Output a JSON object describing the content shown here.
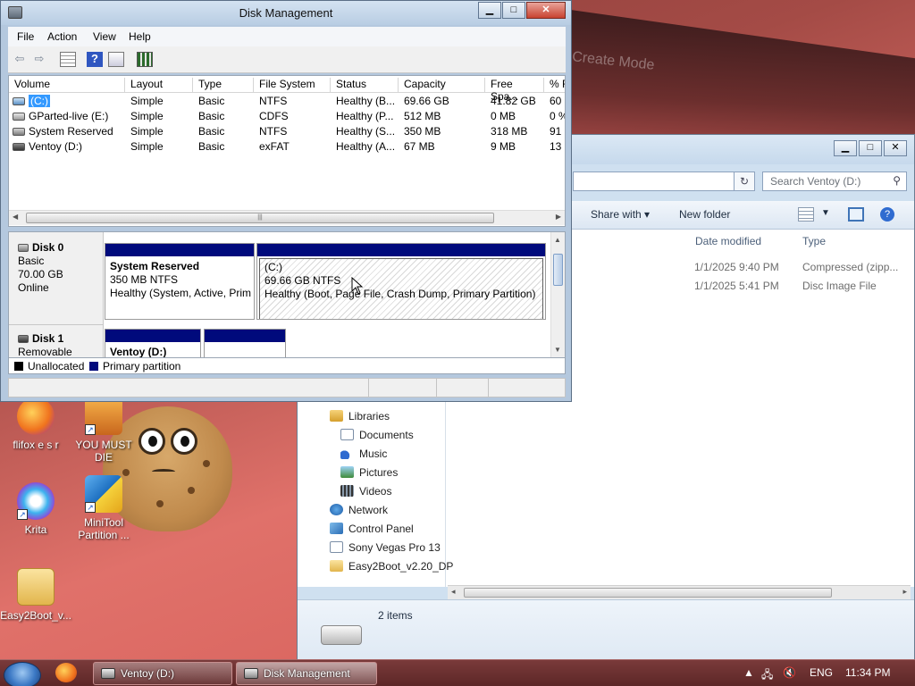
{
  "disk_mgmt": {
    "title": "Disk Management",
    "window_controls": {
      "minimize": "▁",
      "maximize": "□",
      "close": "✕"
    },
    "menu": [
      "File",
      "Action",
      "View",
      "Help"
    ],
    "columns": [
      "Volume",
      "Layout",
      "Type",
      "File System",
      "Status",
      "Capacity",
      "Free Spa...",
      "% F"
    ],
    "volumes": [
      {
        "name": "(C:)",
        "layout": "Simple",
        "type": "Basic",
        "fs": "NTFS",
        "status": "Healthy (B...",
        "capacity": "69.66 GB",
        "free": "41.82 GB",
        "pct": "60"
      },
      {
        "name": "GParted-live (E:)",
        "layout": "Simple",
        "type": "Basic",
        "fs": "CDFS",
        "status": "Healthy (P...",
        "capacity": "512 MB",
        "free": "0 MB",
        "pct": "0 %"
      },
      {
        "name": "System Reserved",
        "layout": "Simple",
        "type": "Basic",
        "fs": "NTFS",
        "status": "Healthy (S...",
        "capacity": "350 MB",
        "free": "318 MB",
        "pct": "91"
      },
      {
        "name": "Ventoy (D:)",
        "layout": "Simple",
        "type": "Basic",
        "fs": "exFAT",
        "status": "Healthy (A...",
        "capacity": "67 MB",
        "free": "9 MB",
        "pct": "13"
      }
    ],
    "disks": [
      {
        "name": "Disk 0",
        "kind": "Basic",
        "size": "70.00 GB",
        "state": "Online",
        "partitions": [
          {
            "title": "System Reserved",
            "line2": "350 MB NTFS",
            "line3": "Healthy (System, Active, Prim"
          },
          {
            "title": "(C:)",
            "line2": "69.66 GB NTFS",
            "line3": "Healthy (Boot, Page File, Crash Dump, Primary Partition)"
          }
        ]
      },
      {
        "name": "Disk 1",
        "kind": "Removable",
        "partitions": [
          {
            "title": "Ventoy (D:)"
          },
          {
            "title": ""
          }
        ]
      }
    ],
    "legend": [
      "Unallocated",
      "Primary partition"
    ],
    "legend_colors": [
      "#000000",
      "#000a7c"
    ]
  },
  "explorer": {
    "window_controls": {
      "minimize": "▁",
      "maximize": "□",
      "close": "✕"
    },
    "search_placeholder": "Search Ventoy (D:)",
    "toolbar": {
      "share_with": "Share with",
      "new_folder": "New folder"
    },
    "columns": [
      "Date modified",
      "Type"
    ],
    "files": [
      {
        "date": "1/1/2025 9:40 PM",
        "type": "Compressed (zipp..."
      },
      {
        "date": "1/1/2025 5:41 PM",
        "type": "Disc Image File"
      }
    ],
    "nav": [
      "Libraries",
      "Documents",
      "Music",
      "Pictures",
      "Videos",
      "Network",
      "Control Panel",
      "Sony Vegas Pro 13",
      "Easy2Boot_v2.20_DP"
    ],
    "status": "2 items"
  },
  "desktop": {
    "icons": [
      "flifox e s r",
      "YOU MUST DIE",
      "Krita",
      "MiniTool Partition ...",
      "Easy2Boot_v..."
    ],
    "wallpaper_text": "Create Mode"
  },
  "taskbar": {
    "tasks": [
      "Ventoy (D:)",
      "Disk Management"
    ],
    "language": "ENG",
    "time": "11:34 PM"
  }
}
